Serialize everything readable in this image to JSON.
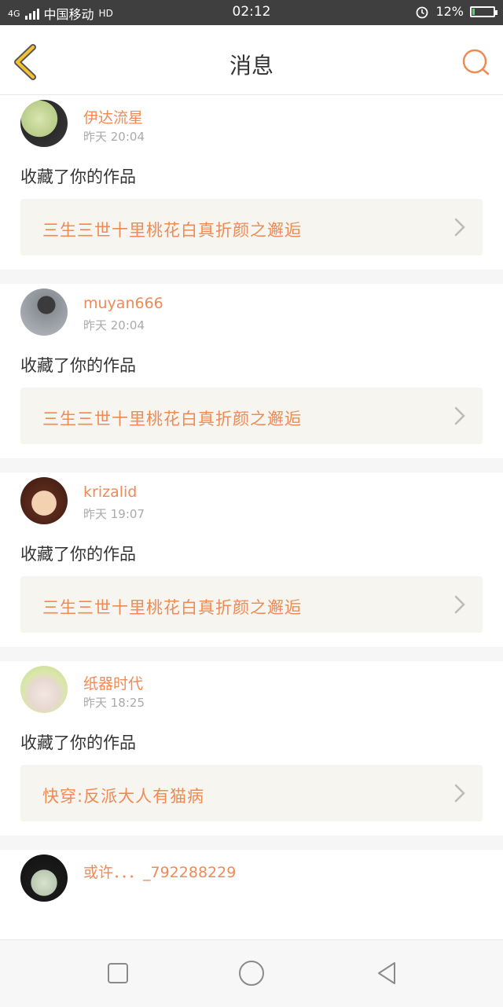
{
  "status_bar": {
    "network": "4G",
    "carrier": "中国移动",
    "volte": "HD",
    "time": "02:12",
    "battery": "12%",
    "battery_level": 0.12
  },
  "header": {
    "title": "消息",
    "back_icon": "chevron-left-icon",
    "search_icon": "search-icon"
  },
  "messages": [
    {
      "user": "伊达流星",
      "time": "昨天 20:04",
      "action": "收藏了你的作品",
      "work": "三生三世十里桃花白真折颜之邂逅"
    },
    {
      "user": "muyan666",
      "time": "昨天 20:04",
      "action": "收藏了你的作品",
      "work": "三生三世十里桃花白真折颜之邂逅"
    },
    {
      "user": "krizalid",
      "time": "昨天 19:07",
      "action": "收藏了你的作品",
      "work": "三生三世十里桃花白真折颜之邂逅"
    },
    {
      "user": "纸器时代",
      "time": "昨天 18:25",
      "action": "收藏了你的作品",
      "work": "快穿:反派大人有猫病"
    },
    {
      "user": "或许．．．_792288229",
      "time": "",
      "action": "",
      "work": ""
    }
  ],
  "nav": {
    "recent_icon": "square-icon",
    "home_icon": "circle-icon",
    "back_icon": "triangle-back-icon"
  },
  "colors": {
    "accent": "#f08a55",
    "work_bg": "#f6f5ef",
    "back_yellow": "#f2c230"
  }
}
